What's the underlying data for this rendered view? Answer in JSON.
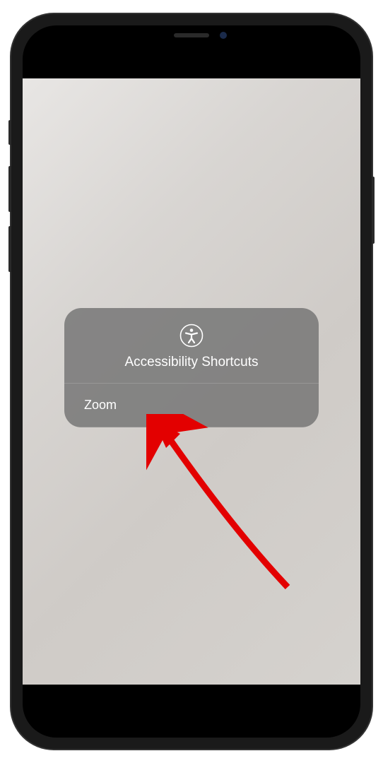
{
  "popup": {
    "title": "Accessibility Shortcuts",
    "items": [
      {
        "label": "Zoom"
      }
    ]
  }
}
